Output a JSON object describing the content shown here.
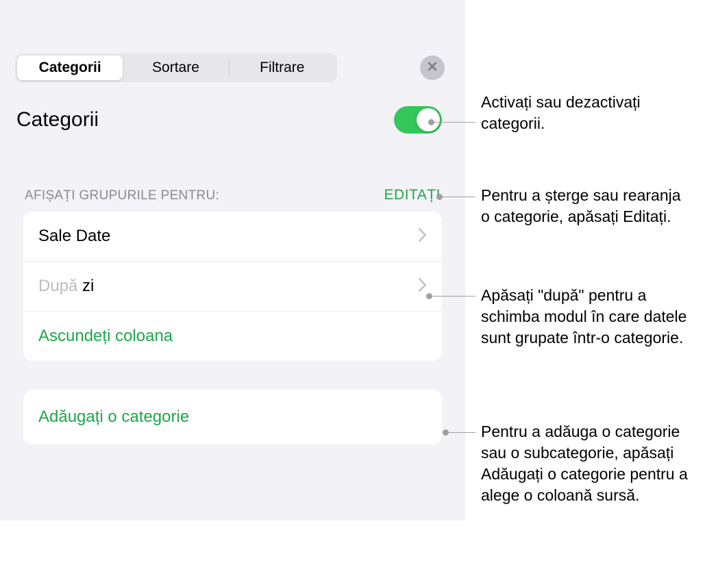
{
  "tabs": {
    "categories": "Categorii",
    "sort": "Sortare",
    "filter": "Filtrare"
  },
  "title": "Categorii",
  "section": {
    "label": "AFIȘAȚI GRUPURILE PENTRU:",
    "edit": "EDITAȚI"
  },
  "rows": {
    "category_name": "Sale Date",
    "by_prefix": "După ",
    "by_unit": "zi",
    "hide_column": "Ascundeți coloana",
    "add_category": "Adăugați o categorie"
  },
  "callouts": {
    "toggle": "Activați sau dezactivați categorii.",
    "edit": "Pentru a șterge sau rearanja o categorie, apăsați Editați.",
    "by": "Apăsați \"după\" pentru a schimba modul în care datele sunt grupate într-o categorie.",
    "add": "Pentru a adăuga o categorie sau o subcategorie, apăsați Adăugați o categorie pentru a alege o coloană sursă."
  }
}
